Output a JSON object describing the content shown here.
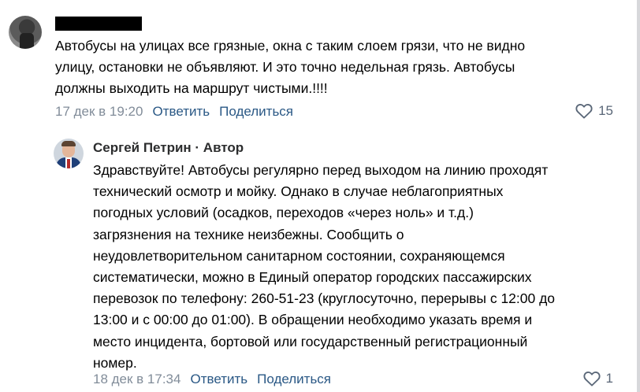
{
  "comments": [
    {
      "author": "",
      "text": "Автобусы на улицах все грязные, окна с таким слоем грязи, что не видно\nулицу, остановки не объявляют. И это точно недельная грязь. Автобусы\nдолжны выходить на маршрут чистыми.!!!!",
      "time": "17 дек в 19:20",
      "reply_label": "Ответить",
      "share_label": "Поделиться",
      "likes": "15"
    },
    {
      "author": "Сергей Петрин · Автор",
      "text": "Здравствуйте! Автобусы регулярно перед выходом на линию проходят\nтехнический осмотр и мойку. Однако в случае неблагоприятных\nпогодных условий (осадков, переходов «через ноль» и т.д.)\nзагрязнения на технике неизбежны. Сообщить о\nнеудовлетворительном санитарном состоянии, сохраняющемся\nсистематически, можно в Единый оператор городских пассажирских\nперевозок по телефону: 260-51-23 (круглосуточно, перерывы с 12:00 до\n13:00 и с 00:00 до 01:00). В обращении необходимо указать время и\nместо инцидента, бортовой или государственный регистрационный\nномер.",
      "time": "18 дек в 17:34",
      "reply_label": "Ответить",
      "share_label": "Поделиться",
      "likes": "1"
    }
  ],
  "colors": {
    "link": "#2a5885",
    "meta": "#818c99"
  },
  "icons": {
    "like": "heart-outline-icon"
  }
}
